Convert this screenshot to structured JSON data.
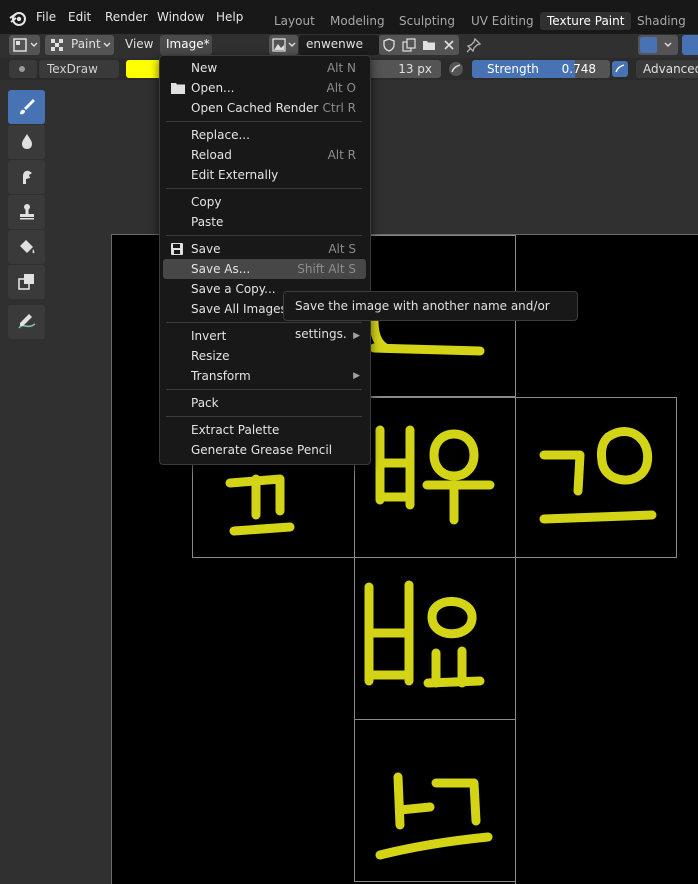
{
  "topbar": {
    "menus": [
      "File",
      "Edit",
      "Render",
      "Window",
      "Help"
    ],
    "workspaces": [
      "Layout",
      "Modeling",
      "Sculpting",
      "UV Editing",
      "Texture Paint",
      "Shading"
    ],
    "active_workspace": "Texture Paint"
  },
  "header": {
    "mode_label": "Paint",
    "view_label": "View",
    "image_menu_label": "Image*",
    "image_name": "enwenwe"
  },
  "tool_settings": {
    "brush_name": "TexDraw",
    "brush_color": "#ffff00",
    "radius": "13 px",
    "strength_label": "Strength",
    "strength_value": "0.748",
    "strength_fraction": 0.748,
    "advanced_label": "Advanced"
  },
  "image_menu": {
    "items": [
      {
        "label": "New",
        "shortcut": "Alt N"
      },
      {
        "label": "Open...",
        "shortcut": "Alt O"
      },
      {
        "label": "Open Cached Render",
        "shortcut": "Ctrl R"
      },
      {
        "label": "Replace...",
        "shortcut": ""
      },
      {
        "label": "Reload",
        "shortcut": "Alt R"
      },
      {
        "label": "Edit Externally",
        "shortcut": ""
      },
      {
        "label": "Copy",
        "shortcut": ""
      },
      {
        "label": "Paste",
        "shortcut": ""
      },
      {
        "label": "Save",
        "shortcut": "Alt S"
      },
      {
        "label": "Save As...",
        "shortcut": "Shift Alt S"
      },
      {
        "label": "Save a Copy...",
        "shortcut": ""
      },
      {
        "label": "Save All Images",
        "shortcut": ""
      },
      {
        "label": "Invert",
        "shortcut": ""
      },
      {
        "label": "Resize",
        "shortcut": ""
      },
      {
        "label": "Transform",
        "shortcut": ""
      },
      {
        "label": "Pack",
        "shortcut": ""
      },
      {
        "label": "Extract Palette",
        "shortcut": ""
      },
      {
        "label": "Generate Grease Pencil",
        "shortcut": ""
      }
    ],
    "highlighted": "Save As..."
  },
  "tooltip": {
    "text": "Save the image with another name and/or settings."
  },
  "colors": {
    "accent": "#4772b3",
    "paint": "#e6e619"
  },
  "icons": [
    "blender-logo-icon",
    "image-editor-icon",
    "chevron-down-icon",
    "paint-mode-icon",
    "image-icon",
    "shield-icon",
    "duplicate-icon",
    "folder-icon",
    "close-icon",
    "pin-icon",
    "brush-icon",
    "drop-icon",
    "smear-icon",
    "clone-stamp-icon",
    "fill-bucket-icon",
    "mask-icon",
    "annotate-icon",
    "folder-open-icon",
    "save-icon",
    "submenu-arrow-icon"
  ]
}
